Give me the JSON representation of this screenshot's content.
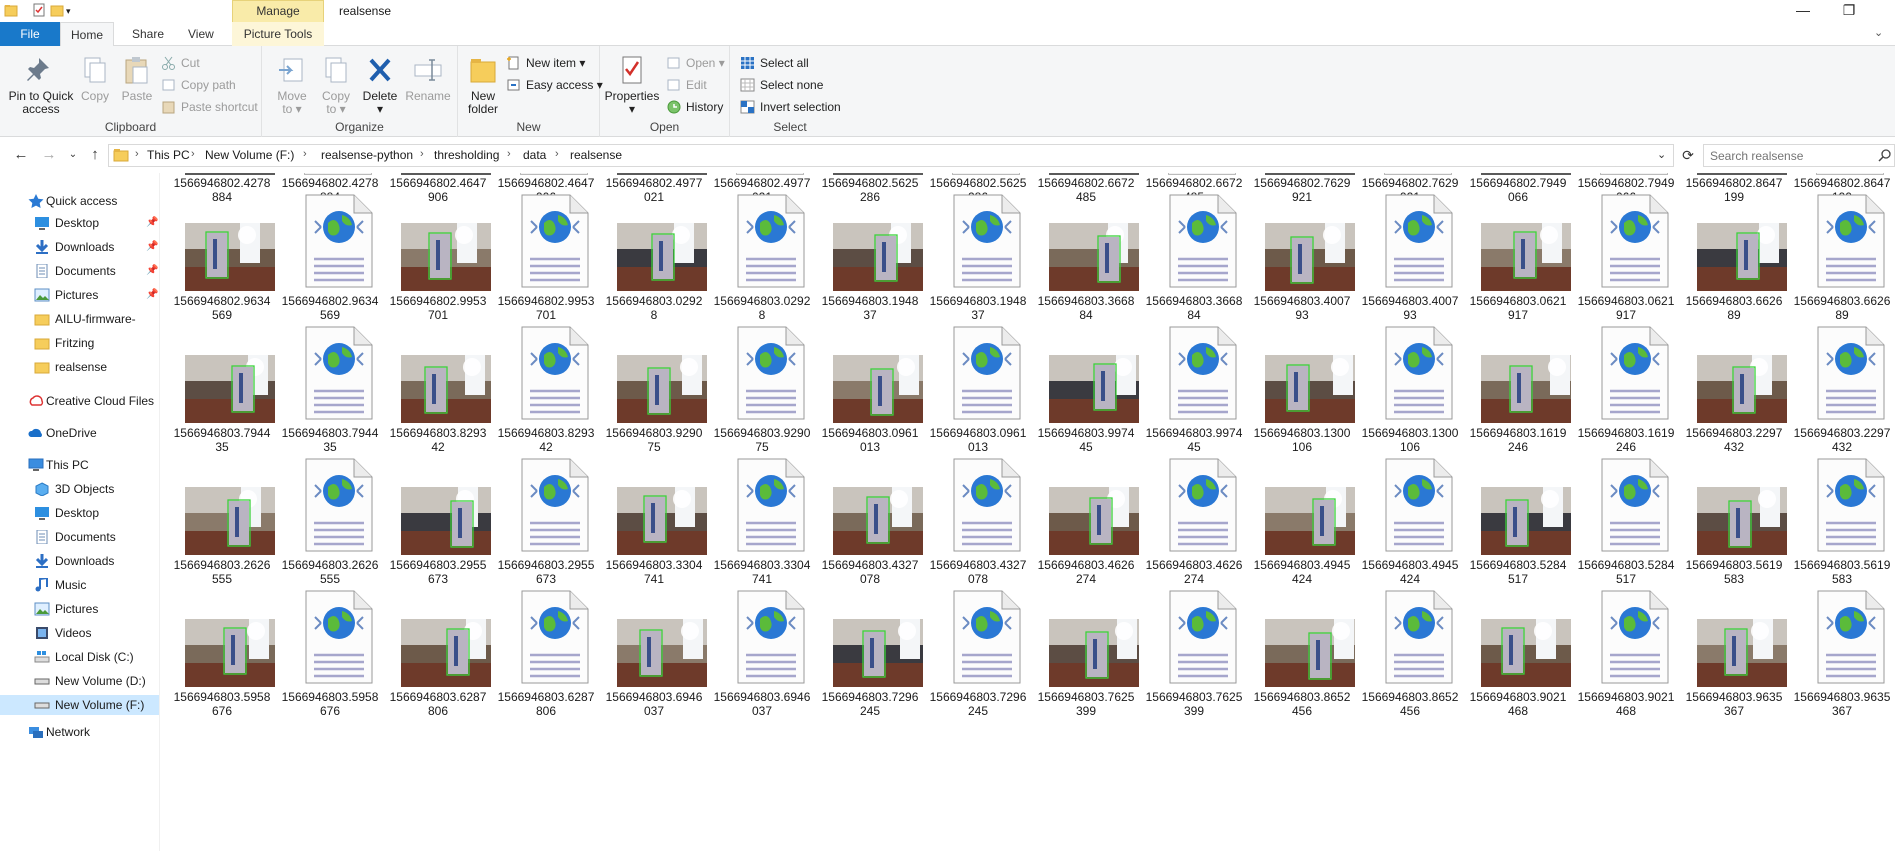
{
  "window": {
    "title": "realsense",
    "context_tab": "Manage",
    "controls": {
      "minimize": "—",
      "restore": "❐"
    }
  },
  "ribbon_tabs": [
    "File",
    "Home",
    "Share",
    "View",
    "Picture Tools"
  ],
  "ribbon": {
    "clipboard": {
      "label": "Clipboard",
      "pin_to_quick_access": [
        "Pin to Quick",
        "access"
      ],
      "copy": "Copy",
      "paste": "Paste",
      "cut": "Cut",
      "copy_path": "Copy path",
      "paste_shortcut": "Paste shortcut"
    },
    "organize": {
      "label": "Organize",
      "move_to": [
        "Move",
        "to ▾"
      ],
      "copy_to": [
        "Copy",
        "to ▾"
      ],
      "delete": [
        "Delete",
        "▾"
      ],
      "rename": "Rename"
    },
    "new": {
      "label": "New",
      "new_folder": [
        "New",
        "folder"
      ],
      "new_item": "New item ▾",
      "easy_access": "Easy access ▾"
    },
    "open": {
      "label": "Open",
      "properties": [
        "Properties",
        "▾"
      ],
      "open_btn": "Open ▾",
      "edit": "Edit",
      "history": "History"
    },
    "select": {
      "label": "Select",
      "select_all": "Select all",
      "select_none": "Select none",
      "invert_selection": "Invert selection"
    }
  },
  "address": {
    "breadcrumbs": [
      "This PC",
      "New Volume (F:)",
      "realsense-python",
      "thresholding",
      "data",
      "realsense"
    ],
    "search_placeholder": "Search realsense"
  },
  "nav": {
    "quick_access": "Quick access",
    "items": [
      {
        "label": "Desktop",
        "pinned": true
      },
      {
        "label": "Downloads",
        "pinned": true
      },
      {
        "label": "Documents",
        "pinned": true
      },
      {
        "label": "Pictures",
        "pinned": true
      },
      {
        "label": "AILU-firmware-",
        "pinned": false
      },
      {
        "label": "Fritzing",
        "pinned": false
      },
      {
        "label": "realsense",
        "pinned": false
      }
    ],
    "creative_cloud": "Creative Cloud Files",
    "onedrive": "OneDrive",
    "this_pc": "This PC",
    "pc_items": [
      "3D Objects",
      "Desktop",
      "Documents",
      "Downloads",
      "Music",
      "Pictures",
      "Videos",
      "Local Disk (C:)",
      "New Volume (D:)",
      "New Volume (F:)"
    ],
    "network": "Network"
  },
  "files": {
    "top_row": [
      [
        "1566946802.4278",
        "884"
      ],
      [
        "1566946802.4278",
        "884"
      ],
      [
        "1566946802.4647",
        "906"
      ],
      [
        "1566946802.4647",
        "906"
      ],
      [
        "1566946802.4977",
        "021"
      ],
      [
        "1566946802.4977",
        "021"
      ],
      [
        "1566946802.5625",
        "286"
      ],
      [
        "1566946802.5625",
        "286"
      ],
      [
        "1566946802.6672",
        "485"
      ],
      [
        "1566946802.6672",
        "485"
      ],
      [
        "1566946802.7629",
        "921"
      ],
      [
        "1566946802.7629",
        "921"
      ],
      [
        "1566946802.7949",
        "066"
      ],
      [
        "1566946802.7949",
        "066"
      ],
      [
        "1566946802.8647",
        "199"
      ],
      [
        "1566946802.8647",
        "199"
      ]
    ],
    "rows": [
      [
        [
          "1566946802.9634",
          "569"
        ],
        [
          "1566946802.9953",
          "701"
        ],
        [
          "1566946803.0292",
          "8"
        ],
        [
          "1566946803.1948",
          "37"
        ],
        [
          "1566946803.3668",
          "84"
        ],
        [
          "1566946803.4007",
          "93"
        ],
        [
          "1566946803.0621",
          "917"
        ],
        [
          "1566946803.6626",
          "89"
        ]
      ],
      [
        [
          "1566946803.7944",
          "35"
        ],
        [
          "1566946803.8293",
          "42"
        ],
        [
          "1566946803.9290",
          "75"
        ],
        [
          "1566946803.0961",
          "013"
        ],
        [
          "1566946803.9974",
          "45"
        ],
        [
          "1566946803.1300",
          "106"
        ],
        [
          "1566946803.1619",
          "246"
        ],
        [
          "1566946803.2297",
          "432"
        ]
      ],
      [
        [
          "1566946803.2626",
          "555"
        ],
        [
          "1566946803.2955",
          "673"
        ],
        [
          "1566946803.3304",
          "741"
        ],
        [
          "1566946803.4327",
          "078"
        ],
        [
          "1566946803.4626",
          "274"
        ],
        [
          "1566946803.4945",
          "424"
        ],
        [
          "1566946803.5284",
          "517"
        ],
        [
          "1566946803.5619",
          "583"
        ]
      ],
      [
        [
          "1566946803.5958",
          "676"
        ],
        [
          "1566946803.6287",
          "806"
        ],
        [
          "1566946803.6946",
          "037"
        ],
        [
          "1566946803.7296",
          "245"
        ],
        [
          "1566946803.7625",
          "399"
        ],
        [
          "1566946803.8652",
          "456"
        ],
        [
          "1566946803.9021",
          "468"
        ],
        [
          "1566946803.9635",
          "367"
        ]
      ]
    ]
  },
  "colors": {
    "file_tab": "#1979ca",
    "manage_tab": "#f9eba9",
    "selection": "#cce8ff",
    "box_green": "#3bd13b"
  }
}
